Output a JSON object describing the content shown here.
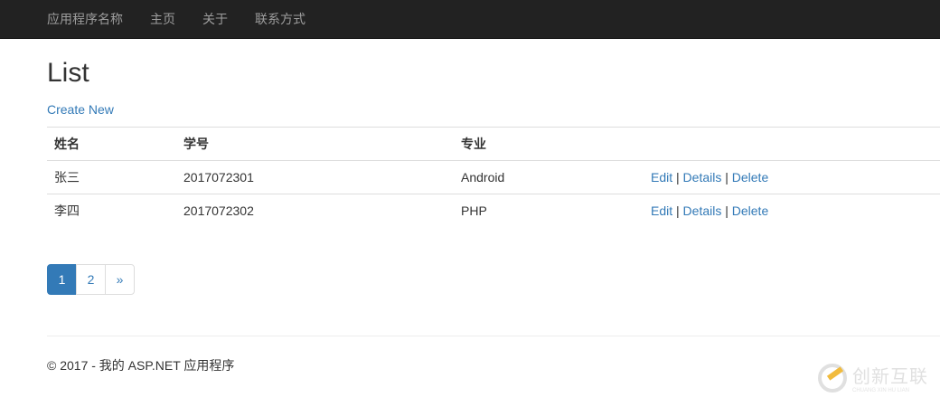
{
  "navbar": {
    "brand": "应用程序名称",
    "links": [
      "主页",
      "关于",
      "联系方式"
    ]
  },
  "page": {
    "title": "List",
    "create_new": "Create New"
  },
  "table": {
    "headers": [
      "姓名",
      "学号",
      "专业",
      ""
    ],
    "rows": [
      {
        "name": "张三",
        "id": "2017072301",
        "major": "Android"
      },
      {
        "name": "李四",
        "id": "2017072302",
        "major": "PHP"
      }
    ],
    "actions": {
      "edit": "Edit",
      "details": "Details",
      "delete": "Delete",
      "sep": "|"
    }
  },
  "pagination": {
    "pages": [
      "1",
      "2"
    ],
    "next": "»",
    "current": "1"
  },
  "footer": {
    "text": "© 2017 - 我的 ASP.NET 应用程序"
  },
  "watermark": {
    "cn": "创新互联",
    "en": "CHUANG XIN HU LIAN"
  },
  "colors": {
    "link": "#337ab7",
    "navbar": "#222222"
  }
}
